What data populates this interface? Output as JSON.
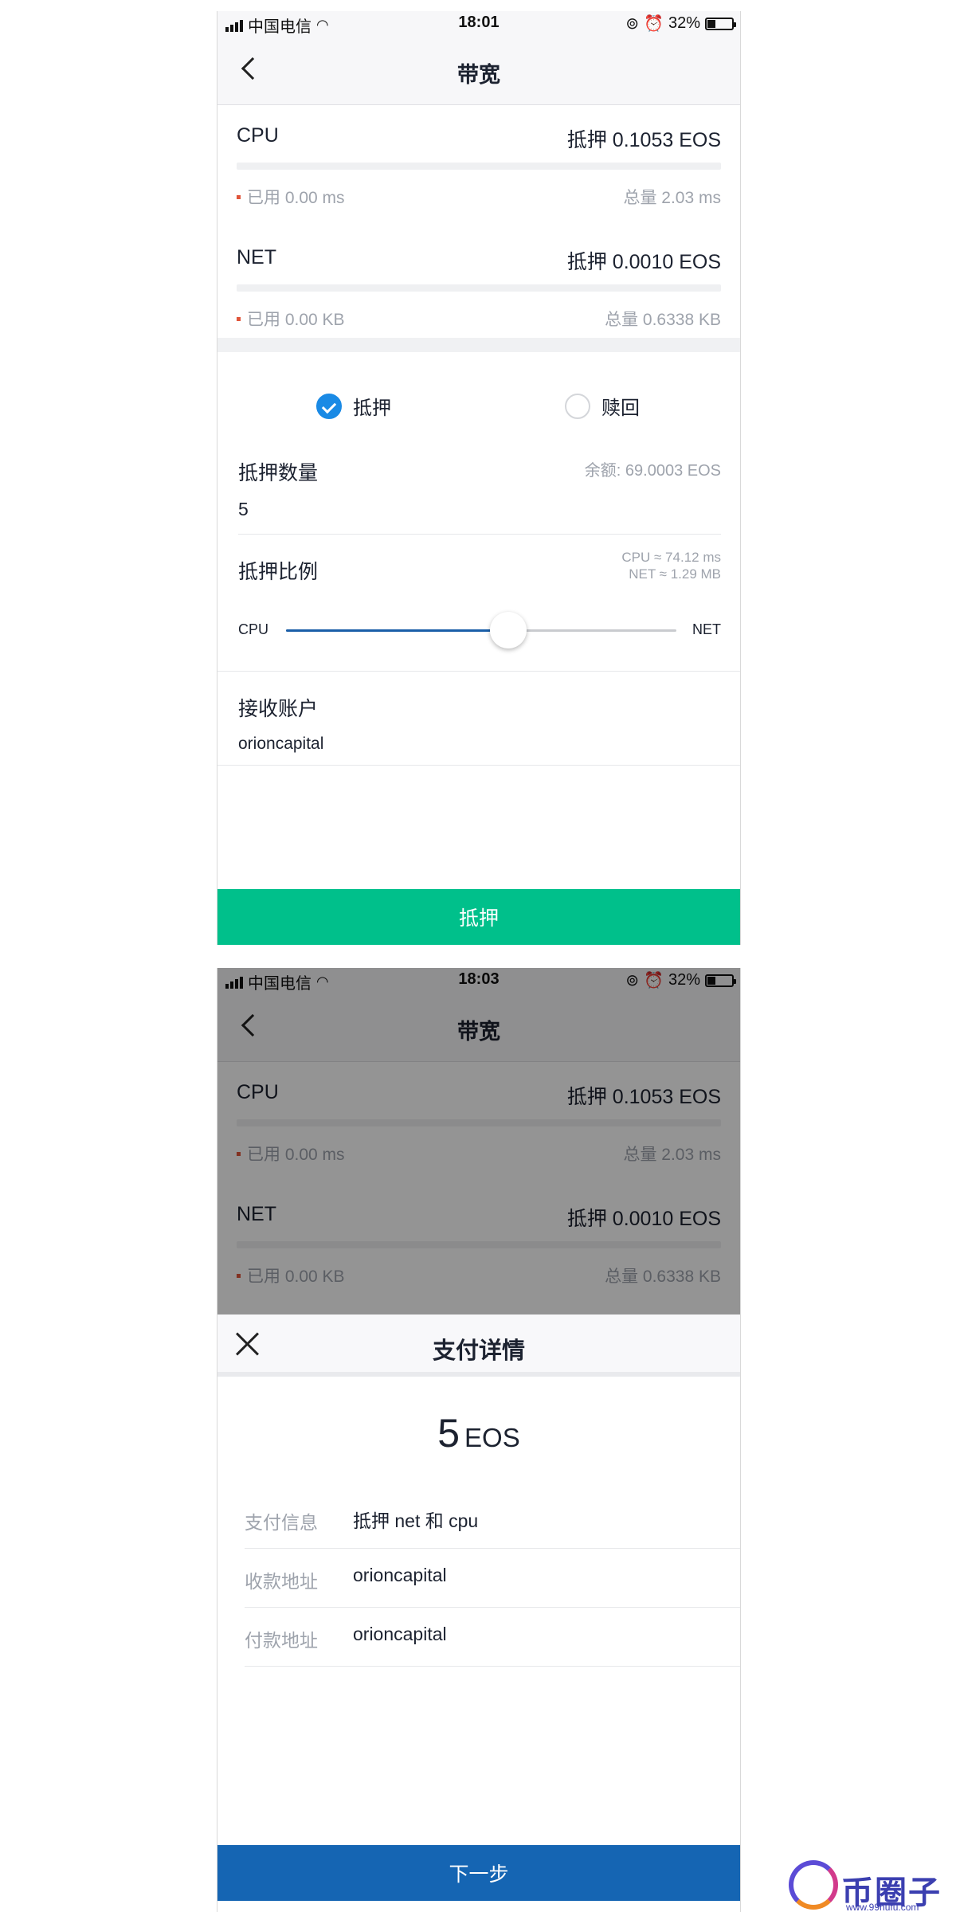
{
  "screen1": {
    "status": {
      "carrier": "中国电信",
      "time": "18:01",
      "battery": "32%"
    },
    "nav_title": "带宽",
    "cpu": {
      "name": "CPU",
      "stake": "抵押 0.1053 EOS",
      "used": "已用 0.00 ms",
      "total": "总量 2.03 ms"
    },
    "net": {
      "name": "NET",
      "stake": "抵押 0.0010 EOS",
      "used": "已用 0.00 KB",
      "total": "总量 0.6338 KB"
    },
    "options": {
      "stake": "抵押",
      "refund": "赎回",
      "selected": "stake"
    },
    "amount": {
      "label": "抵押数量",
      "balance": "余额: 69.0003 EOS",
      "value": "5"
    },
    "ratio": {
      "label": "抵押比例",
      "cpu_estimate": "CPU ≈ 74.12 ms",
      "net_estimate": "NET ≈ 1.29 MB",
      "left_label": "CPU",
      "right_label": "NET",
      "position_fraction": 0.57
    },
    "receiver": {
      "label": "接收账户",
      "value": "orioncapital"
    },
    "submit_label": "抵押",
    "colors": {
      "submit": "#00c08b",
      "accent": "#1a8ae5",
      "slider": "#1a5ea8"
    }
  },
  "screen2": {
    "status": {
      "carrier": "中国电信",
      "time": "18:03",
      "battery": "32%"
    },
    "nav_title": "带宽",
    "cpu": {
      "name": "CPU",
      "stake": "抵押 0.1053 EOS",
      "used": "已用 0.00 ms",
      "total": "总量 2.03 ms"
    },
    "net": {
      "name": "NET",
      "stake": "抵押 0.0010 EOS",
      "used": "已用 0.00 KB",
      "total": "总量 0.6338 KB"
    },
    "sheet": {
      "title": "支付详情",
      "amount": "5",
      "unit": "EOS",
      "rows": [
        {
          "key": "支付信息",
          "value": "抵押 net 和 cpu"
        },
        {
          "key": "收款地址",
          "value": "orioncapital"
        },
        {
          "key": "付款地址",
          "value": "orioncapital"
        }
      ],
      "next_label": "下一步"
    },
    "colors": {
      "next": "#1565b3"
    }
  },
  "watermark": {
    "text": "币圈子",
    "url": "www.99hufu.com"
  }
}
